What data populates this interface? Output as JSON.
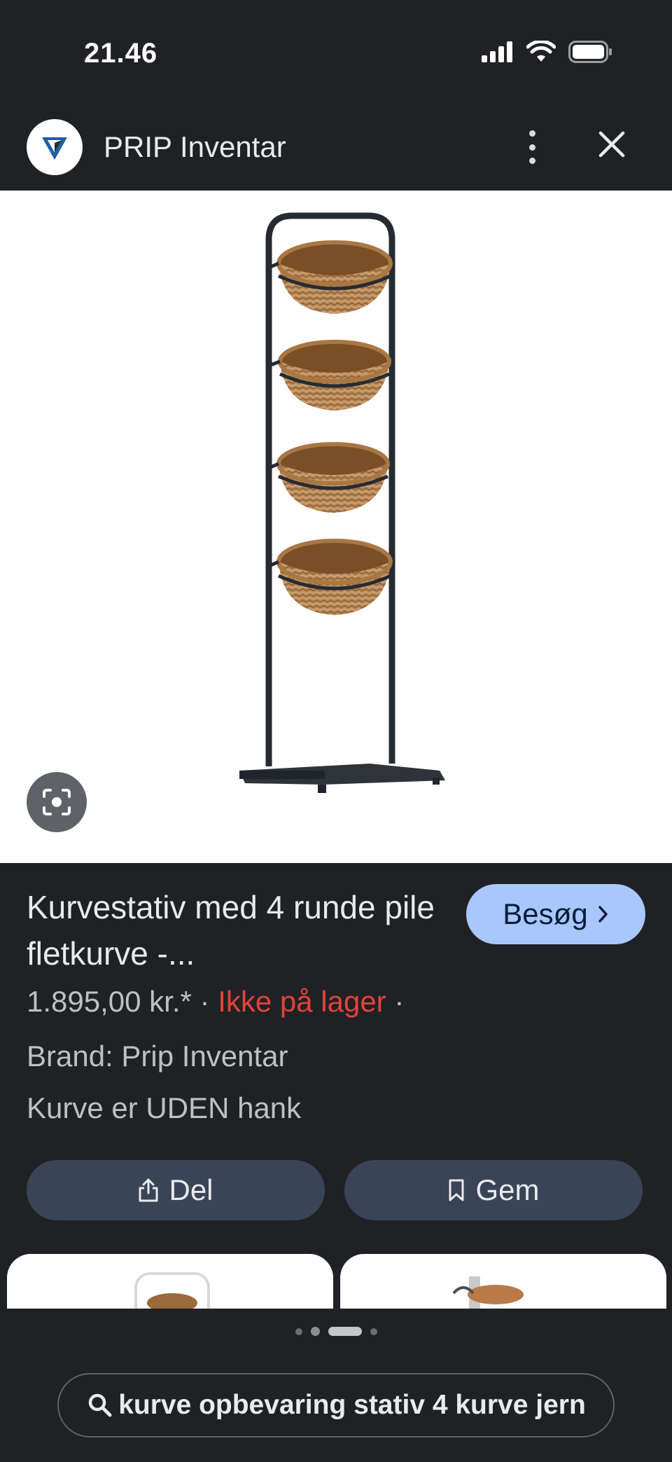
{
  "status_bar": {
    "time": "21.46"
  },
  "header": {
    "site_name": "PRIP Inventar",
    "logo_icon": "prip-logo-icon",
    "more_icon": "more-vertical-icon",
    "close_icon": "close-icon"
  },
  "product": {
    "title": "Kurvestativ med 4 runde pile fletkurve -...",
    "visit_label": "Besøg",
    "price": "1.895,00 kr.*",
    "separator": "·",
    "stock": "Ikke på lager",
    "brand": "Brand: Prip Inventar",
    "description": "Kurve er UDEN hank",
    "colors": {
      "stock": "#e0443a",
      "visit_button": "#a8c7fa",
      "action_button": "#394457"
    }
  },
  "actions": {
    "share_label": "Del",
    "save_label": "Gem"
  },
  "search": {
    "query": "kurve opbevaring stativ 4 kurve jern"
  }
}
